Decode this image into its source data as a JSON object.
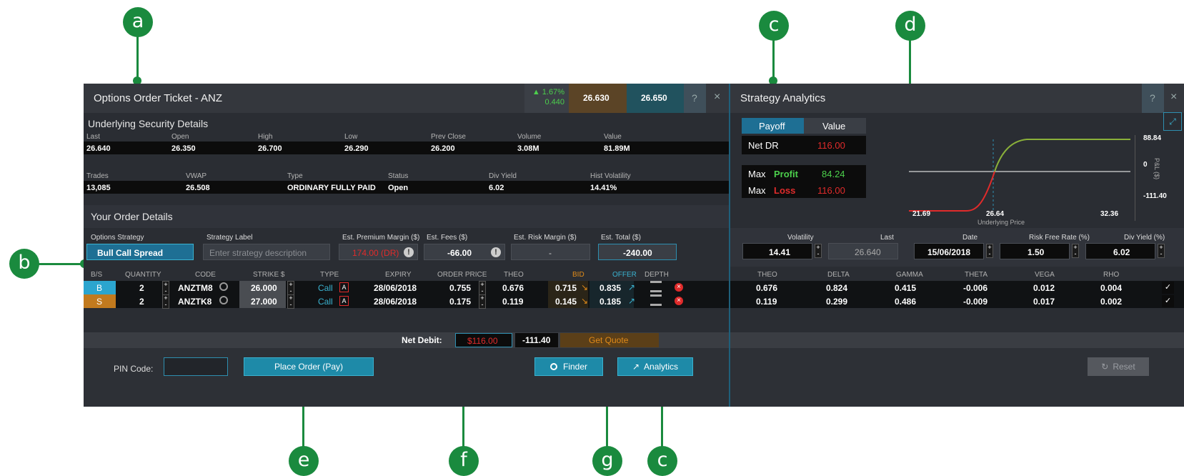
{
  "callouts": [
    "a",
    "b",
    "c",
    "d",
    "e",
    "f",
    "g",
    "c"
  ],
  "ticket": {
    "title": "Options Order Ticket - ANZ",
    "change_pct": "▲ 1.67%",
    "change_val": "0.440",
    "bid_price": "26.630",
    "ask_price": "26.650",
    "help": "?",
    "close": "×"
  },
  "underlying": {
    "section_title": "Underlying Security Details",
    "row1_labels": [
      "Last",
      "Open",
      "High",
      "Low",
      "Prev Close",
      "Volume",
      "Value"
    ],
    "row1_values": [
      "26.640",
      "26.350",
      "26.700",
      "26.290",
      "26.200",
      "3.08M",
      "81.89M"
    ],
    "row2_labels": [
      "Trades",
      "VWAP",
      "Type",
      "Status",
      "Div Yield",
      "Hist Volatility"
    ],
    "row2_values": [
      "13,085",
      "26.508",
      "ORDINARY FULLY PAID",
      "Open",
      "6.02",
      "14.41%"
    ]
  },
  "order": {
    "section_title": "Your Order Details",
    "strategy_label": "Options Strategy",
    "strategy_value": "Bull Call Spread",
    "label_label": "Strategy Label",
    "label_placeholder": "Enter strategy description",
    "premium_label": "Est. Premium Margin ($)",
    "premium_value": "174.00 (DR)",
    "fees_label": "Est. Fees ($)",
    "fees_value": "-66.00",
    "risk_label": "Est. Risk Margin ($)",
    "risk_value": "-",
    "total_label": "Est. Total ($)",
    "total_value": "-240.00"
  },
  "legs_headers": [
    "B/S",
    "QUANTITY",
    "CODE",
    "STRIKE $",
    "TYPE",
    "EXPIRY",
    "ORDER PRICE",
    "THEO",
    "BID",
    "OFFER",
    "DEPTH"
  ],
  "legs": [
    {
      "bs": "B",
      "qty": "2",
      "code": "ANZTM8",
      "strike": "26.000",
      "type": "Call",
      "a": "A",
      "expiry": "28/06/2018",
      "price": "0.755",
      "theo": "0.676",
      "bid": "0.715",
      "offer": "0.835"
    },
    {
      "bs": "S",
      "qty": "2",
      "code": "ANZTK8",
      "strike": "27.000",
      "type": "Call",
      "a": "A",
      "expiry": "28/06/2018",
      "price": "0.175",
      "theo": "0.119",
      "bid": "0.145",
      "offer": "0.185"
    }
  ],
  "net": {
    "label": "Net Debit:",
    "debit": "$116.00",
    "value": "-111.40",
    "get_quote": "Get Quote"
  },
  "footer": {
    "pin_label": "PIN Code:",
    "place_order": "Place Order (Pay)",
    "finder": "Finder",
    "analytics": "Analytics"
  },
  "strategy": {
    "title": "Strategy Analytics",
    "help": "?",
    "close": "×",
    "tab_payoff": "Payoff",
    "tab_value": "Value",
    "net_label": "Net DR",
    "net_value": "116.00",
    "max": "Max",
    "profit_label": "Profit",
    "profit_value": "84.24",
    "loss_label": "Loss",
    "loss_value": "116.00",
    "y_top": "88.84",
    "y_zero": "0",
    "y_bottom": "-111.40",
    "y_axis": "P&L ($)",
    "x_left": "21.69",
    "x_mid": "26.64",
    "x_right": "32.36",
    "x_axis": "Underlying Price",
    "param_labels": [
      "Volatility",
      "Last",
      "Date",
      "Risk Free Rate (%)",
      "Div Yield (%)"
    ],
    "param_values": [
      "14.41",
      "26.640",
      "15/06/2018",
      "1.50",
      "6.02"
    ],
    "greek_headers": [
      "THEO",
      "DELTA",
      "GAMMA",
      "THETA",
      "VEGA",
      "RHO"
    ],
    "greeks": [
      [
        "0.676",
        "0.824",
        "0.415",
        "-0.006",
        "0.012",
        "0.004"
      ],
      [
        "0.119",
        "0.299",
        "0.486",
        "-0.009",
        "0.017",
        "0.002"
      ]
    ],
    "reset": "Reset"
  },
  "colors": {
    "accent": "#1e8aa8",
    "callout": "#1a8a3e",
    "red": "#e02b2b",
    "green": "#4ccf4c",
    "orange": "#e08a18"
  }
}
